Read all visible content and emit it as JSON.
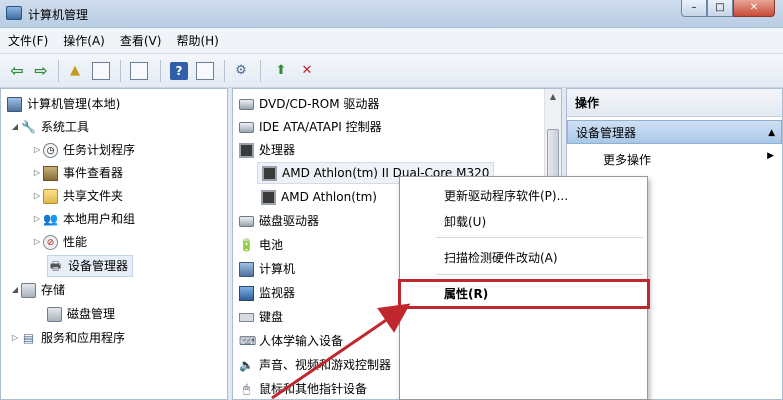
{
  "window": {
    "title": "计算机管理"
  },
  "window_controls": {
    "minimize": "–",
    "maximize": "□",
    "close": "✕"
  },
  "menubar": {
    "items": [
      "文件(F)",
      "操作(A)",
      "查看(V)",
      "帮助(H)"
    ]
  },
  "toolbar": {
    "back": "⇦",
    "forward": "⇨",
    "help": "?"
  },
  "left_tree": {
    "root": "计算机管理(本地)",
    "system_tools": "系统工具",
    "task_scheduler": "任务计划程序",
    "event_viewer": "事件查看器",
    "shared_folders": "共享文件夹",
    "local_users": "本地用户和组",
    "performance": "性能",
    "device_manager": "设备管理器",
    "storage": "存储",
    "disk_management": "磁盘管理",
    "services": "服务和应用程序"
  },
  "device_tree": {
    "dvd": "DVD/CD-ROM 驱动器",
    "ide": "IDE ATA/ATAPI 控制器",
    "processors": "处理器",
    "cpu1": "AMD Athlon(tm) II Dual-Core M320",
    "cpu2": "AMD Athlon(tm)",
    "disk_drives": "磁盘驱动器",
    "battery": "电池",
    "computer": "计算机",
    "monitors": "监视器",
    "keyboard": "键盘",
    "hid": "人体学输入设备",
    "sound": "声音、视频和游戏控制器",
    "mice": "鼠标和其他指针设备"
  },
  "actions_pane": {
    "header": "操作",
    "section": "设备管理器",
    "more": "更多操作"
  },
  "context_menu": {
    "update_driver": "更新驱动程序软件(P)...",
    "uninstall": "卸载(U)",
    "scan": "扫描检测硬件改动(A)",
    "properties": "属性(R)"
  },
  "colors": {
    "highlight_box": "#c0272d",
    "arrow": "#c0272d"
  }
}
